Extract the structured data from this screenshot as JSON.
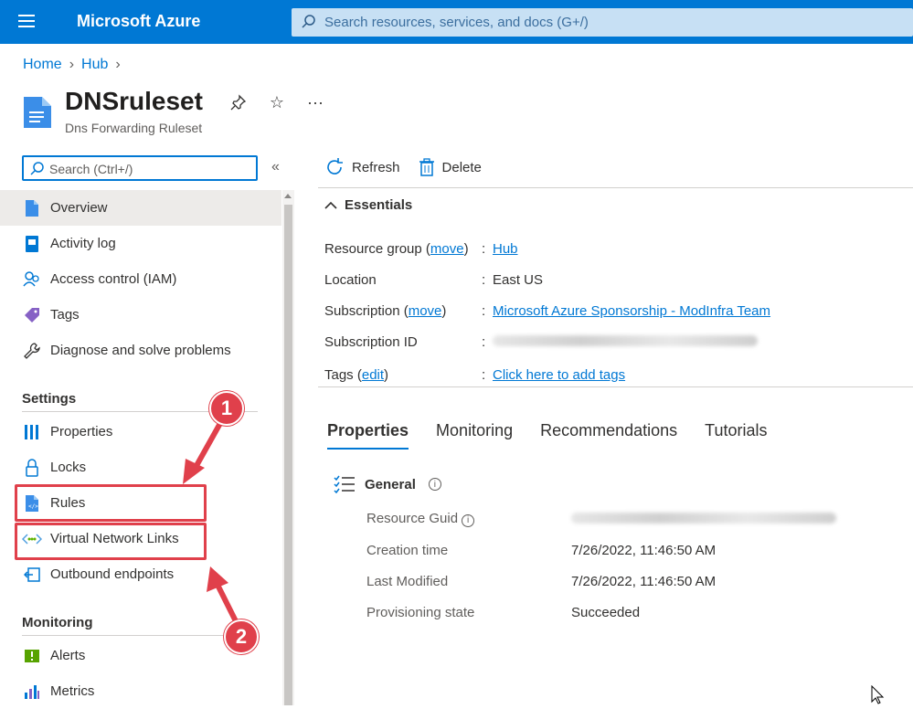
{
  "topbar": {
    "brand": "Microsoft Azure",
    "search_placeholder": "Search resources, services, and docs (G+/)"
  },
  "breadcrumb": [
    "Home",
    "Hub"
  ],
  "resource": {
    "title": "DNSruleset",
    "subtitle": "Dns Forwarding Ruleset"
  },
  "leftnav": {
    "search_placeholder": "Search (Ctrl+/)",
    "items_top": [
      {
        "label": "Overview",
        "icon": "overview-doc-icon"
      },
      {
        "label": "Activity log",
        "icon": "activity-log-icon"
      },
      {
        "label": "Access control (IAM)",
        "icon": "people-icon"
      },
      {
        "label": "Tags",
        "icon": "tag-icon"
      },
      {
        "label": "Diagnose and solve problems",
        "icon": "wrench-icon"
      }
    ],
    "settings_header": "Settings",
    "items_settings": [
      {
        "label": "Properties",
        "icon": "properties-bars-icon"
      },
      {
        "label": "Locks",
        "icon": "lock-icon"
      },
      {
        "label": "Rules",
        "icon": "rules-doc-icon"
      },
      {
        "label": "Virtual Network Links",
        "icon": "vnet-link-icon"
      },
      {
        "label": "Outbound endpoints",
        "icon": "outbound-icon"
      }
    ],
    "monitoring_header": "Monitoring",
    "items_monitoring": [
      {
        "label": "Alerts",
        "icon": "alert-icon"
      },
      {
        "label": "Metrics",
        "icon": "metrics-icon"
      }
    ]
  },
  "toolbar": {
    "refresh": "Refresh",
    "delete": "Delete"
  },
  "essentials": {
    "header": "Essentials",
    "resource_group_label": "Resource group",
    "move": "move",
    "resource_group_value": "Hub",
    "location_label": "Location",
    "location_value": "East US",
    "subscription_label": "Subscription",
    "subscription_value": "Microsoft Azure Sponsorship - ModInfra Team",
    "subscription_id_label": "Subscription ID",
    "tags_label": "Tags",
    "edit": "edit",
    "tags_value": "Click here to add tags"
  },
  "tabs": [
    "Properties",
    "Monitoring",
    "Recommendations",
    "Tutorials"
  ],
  "general": {
    "header": "General",
    "resource_guid_label": "Resource Guid",
    "creation_time_label": "Creation time",
    "creation_time_value": "7/26/2022, 11:46:50 AM",
    "last_modified_label": "Last Modified",
    "last_modified_value": "7/26/2022, 11:46:50 AM",
    "provisioning_state_label": "Provisioning state",
    "provisioning_state_value": "Succeeded"
  },
  "callouts": [
    "1",
    "2"
  ],
  "colors": {
    "accent": "#0078d4",
    "highlight": "#e0404b"
  }
}
